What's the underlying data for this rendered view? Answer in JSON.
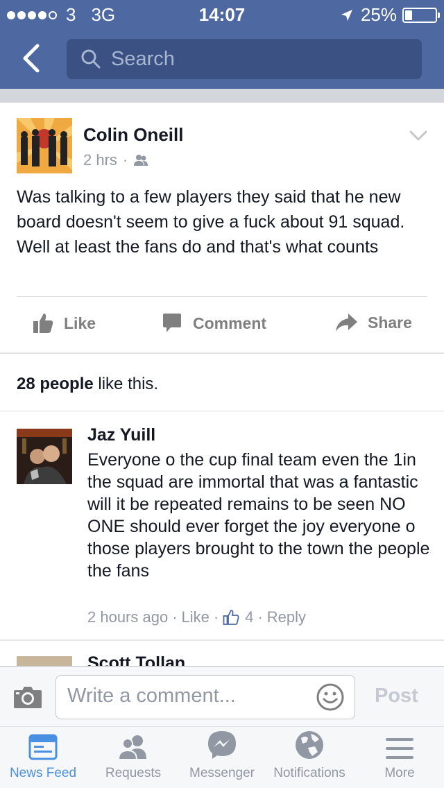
{
  "status_bar": {
    "carrier": "3",
    "network": "3G",
    "time": "14:07",
    "battery": "25%"
  },
  "nav": {
    "search_placeholder": "Search"
  },
  "post": {
    "author": "Colin Oneill",
    "time": "2 hrs",
    "text": "Was talking to a few players they said that he new board doesn't seem to give a fuck about 91 squad. Well at least the fans do and that's what counts",
    "actions": {
      "like": "Like",
      "comment": "Comment",
      "share": "Share"
    }
  },
  "likes": {
    "count": "28 people",
    "suffix": " like this."
  },
  "comments": [
    {
      "author": "Jaz Yuill",
      "text": "Everyone o the cup final team even the 1in the squad are immortal that was a fantastic will it be repeated remains to be seen NO ONE should ever forget the joy everyone o those players brought to the town the people the fans",
      "time": "2 hours ago",
      "like": "Like",
      "like_count": "4",
      "reply": "Reply"
    },
    {
      "author": "Scott Tollan"
    }
  ],
  "composer": {
    "placeholder": "Write a comment...",
    "post_label": "Post"
  },
  "tabbar": [
    {
      "label": "News Feed",
      "icon": "news-feed-icon"
    },
    {
      "label": "Requests",
      "icon": "requests-icon"
    },
    {
      "label": "Messenger",
      "icon": "messenger-icon"
    },
    {
      "label": "Notifications",
      "icon": "globe-icon"
    },
    {
      "label": "More",
      "icon": "menu-icon"
    }
  ],
  "colors": {
    "header": "#4e69a2",
    "search_box": "#3b5184",
    "active_tab": "#4a90e2",
    "muted_text": "#9197a3"
  }
}
